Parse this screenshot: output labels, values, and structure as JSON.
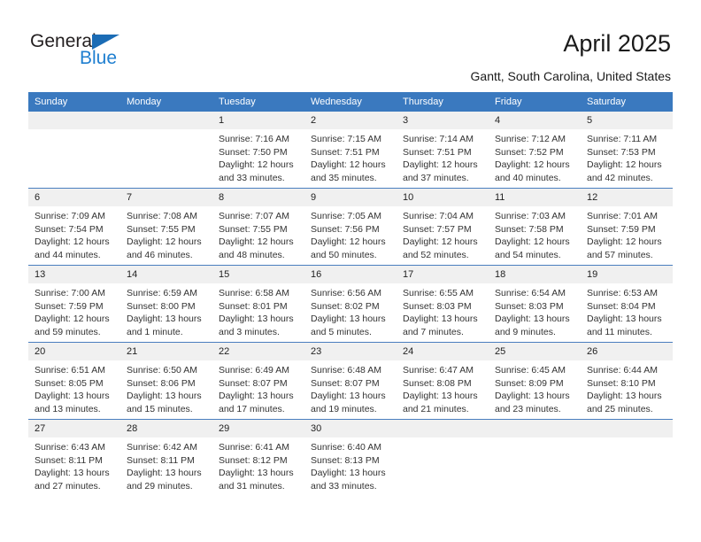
{
  "brand": {
    "name_part1": "General",
    "name_part2": "Blue",
    "triangle_icon": "triangle-icon",
    "accent_color": "#1f7fd0"
  },
  "header": {
    "title": "April 2025",
    "location": "Gantt, South Carolina, United States"
  },
  "calendar": {
    "header_bg": "#3a79bf",
    "daynum_bg": "#f0f0f0",
    "separator_color": "#4a7ebf",
    "weekdays": [
      "Sunday",
      "Monday",
      "Tuesday",
      "Wednesday",
      "Thursday",
      "Friday",
      "Saturday"
    ],
    "weeks": [
      [
        {
          "day": "",
          "sunrise": "",
          "sunset": "",
          "daylight_line1": "",
          "daylight_line2": ""
        },
        {
          "day": "",
          "sunrise": "",
          "sunset": "",
          "daylight_line1": "",
          "daylight_line2": ""
        },
        {
          "day": "1",
          "sunrise": "Sunrise: 7:16 AM",
          "sunset": "Sunset: 7:50 PM",
          "daylight_line1": "Daylight: 12 hours",
          "daylight_line2": "and 33 minutes."
        },
        {
          "day": "2",
          "sunrise": "Sunrise: 7:15 AM",
          "sunset": "Sunset: 7:51 PM",
          "daylight_line1": "Daylight: 12 hours",
          "daylight_line2": "and 35 minutes."
        },
        {
          "day": "3",
          "sunrise": "Sunrise: 7:14 AM",
          "sunset": "Sunset: 7:51 PM",
          "daylight_line1": "Daylight: 12 hours",
          "daylight_line2": "and 37 minutes."
        },
        {
          "day": "4",
          "sunrise": "Sunrise: 7:12 AM",
          "sunset": "Sunset: 7:52 PM",
          "daylight_line1": "Daylight: 12 hours",
          "daylight_line2": "and 40 minutes."
        },
        {
          "day": "5",
          "sunrise": "Sunrise: 7:11 AM",
          "sunset": "Sunset: 7:53 PM",
          "daylight_line1": "Daylight: 12 hours",
          "daylight_line2": "and 42 minutes."
        }
      ],
      [
        {
          "day": "6",
          "sunrise": "Sunrise: 7:09 AM",
          "sunset": "Sunset: 7:54 PM",
          "daylight_line1": "Daylight: 12 hours",
          "daylight_line2": "and 44 minutes."
        },
        {
          "day": "7",
          "sunrise": "Sunrise: 7:08 AM",
          "sunset": "Sunset: 7:55 PM",
          "daylight_line1": "Daylight: 12 hours",
          "daylight_line2": "and 46 minutes."
        },
        {
          "day": "8",
          "sunrise": "Sunrise: 7:07 AM",
          "sunset": "Sunset: 7:55 PM",
          "daylight_line1": "Daylight: 12 hours",
          "daylight_line2": "and 48 minutes."
        },
        {
          "day": "9",
          "sunrise": "Sunrise: 7:05 AM",
          "sunset": "Sunset: 7:56 PM",
          "daylight_line1": "Daylight: 12 hours",
          "daylight_line2": "and 50 minutes."
        },
        {
          "day": "10",
          "sunrise": "Sunrise: 7:04 AM",
          "sunset": "Sunset: 7:57 PM",
          "daylight_line1": "Daylight: 12 hours",
          "daylight_line2": "and 52 minutes."
        },
        {
          "day": "11",
          "sunrise": "Sunrise: 7:03 AM",
          "sunset": "Sunset: 7:58 PM",
          "daylight_line1": "Daylight: 12 hours",
          "daylight_line2": "and 54 minutes."
        },
        {
          "day": "12",
          "sunrise": "Sunrise: 7:01 AM",
          "sunset": "Sunset: 7:59 PM",
          "daylight_line1": "Daylight: 12 hours",
          "daylight_line2": "and 57 minutes."
        }
      ],
      [
        {
          "day": "13",
          "sunrise": "Sunrise: 7:00 AM",
          "sunset": "Sunset: 7:59 PM",
          "daylight_line1": "Daylight: 12 hours",
          "daylight_line2": "and 59 minutes."
        },
        {
          "day": "14",
          "sunrise": "Sunrise: 6:59 AM",
          "sunset": "Sunset: 8:00 PM",
          "daylight_line1": "Daylight: 13 hours",
          "daylight_line2": "and 1 minute."
        },
        {
          "day": "15",
          "sunrise": "Sunrise: 6:58 AM",
          "sunset": "Sunset: 8:01 PM",
          "daylight_line1": "Daylight: 13 hours",
          "daylight_line2": "and 3 minutes."
        },
        {
          "day": "16",
          "sunrise": "Sunrise: 6:56 AM",
          "sunset": "Sunset: 8:02 PM",
          "daylight_line1": "Daylight: 13 hours",
          "daylight_line2": "and 5 minutes."
        },
        {
          "day": "17",
          "sunrise": "Sunrise: 6:55 AM",
          "sunset": "Sunset: 8:03 PM",
          "daylight_line1": "Daylight: 13 hours",
          "daylight_line2": "and 7 minutes."
        },
        {
          "day": "18",
          "sunrise": "Sunrise: 6:54 AM",
          "sunset": "Sunset: 8:03 PM",
          "daylight_line1": "Daylight: 13 hours",
          "daylight_line2": "and 9 minutes."
        },
        {
          "day": "19",
          "sunrise": "Sunrise: 6:53 AM",
          "sunset": "Sunset: 8:04 PM",
          "daylight_line1": "Daylight: 13 hours",
          "daylight_line2": "and 11 minutes."
        }
      ],
      [
        {
          "day": "20",
          "sunrise": "Sunrise: 6:51 AM",
          "sunset": "Sunset: 8:05 PM",
          "daylight_line1": "Daylight: 13 hours",
          "daylight_line2": "and 13 minutes."
        },
        {
          "day": "21",
          "sunrise": "Sunrise: 6:50 AM",
          "sunset": "Sunset: 8:06 PM",
          "daylight_line1": "Daylight: 13 hours",
          "daylight_line2": "and 15 minutes."
        },
        {
          "day": "22",
          "sunrise": "Sunrise: 6:49 AM",
          "sunset": "Sunset: 8:07 PM",
          "daylight_line1": "Daylight: 13 hours",
          "daylight_line2": "and 17 minutes."
        },
        {
          "day": "23",
          "sunrise": "Sunrise: 6:48 AM",
          "sunset": "Sunset: 8:07 PM",
          "daylight_line1": "Daylight: 13 hours",
          "daylight_line2": "and 19 minutes."
        },
        {
          "day": "24",
          "sunrise": "Sunrise: 6:47 AM",
          "sunset": "Sunset: 8:08 PM",
          "daylight_line1": "Daylight: 13 hours",
          "daylight_line2": "and 21 minutes."
        },
        {
          "day": "25",
          "sunrise": "Sunrise: 6:45 AM",
          "sunset": "Sunset: 8:09 PM",
          "daylight_line1": "Daylight: 13 hours",
          "daylight_line2": "and 23 minutes."
        },
        {
          "day": "26",
          "sunrise": "Sunrise: 6:44 AM",
          "sunset": "Sunset: 8:10 PM",
          "daylight_line1": "Daylight: 13 hours",
          "daylight_line2": "and 25 minutes."
        }
      ],
      [
        {
          "day": "27",
          "sunrise": "Sunrise: 6:43 AM",
          "sunset": "Sunset: 8:11 PM",
          "daylight_line1": "Daylight: 13 hours",
          "daylight_line2": "and 27 minutes."
        },
        {
          "day": "28",
          "sunrise": "Sunrise: 6:42 AM",
          "sunset": "Sunset: 8:11 PM",
          "daylight_line1": "Daylight: 13 hours",
          "daylight_line2": "and 29 minutes."
        },
        {
          "day": "29",
          "sunrise": "Sunrise: 6:41 AM",
          "sunset": "Sunset: 8:12 PM",
          "daylight_line1": "Daylight: 13 hours",
          "daylight_line2": "and 31 minutes."
        },
        {
          "day": "30",
          "sunrise": "Sunrise: 6:40 AM",
          "sunset": "Sunset: 8:13 PM",
          "daylight_line1": "Daylight: 13 hours",
          "daylight_line2": "and 33 minutes."
        },
        {
          "day": "",
          "sunrise": "",
          "sunset": "",
          "daylight_line1": "",
          "daylight_line2": ""
        },
        {
          "day": "",
          "sunrise": "",
          "sunset": "",
          "daylight_line1": "",
          "daylight_line2": ""
        },
        {
          "day": "",
          "sunrise": "",
          "sunset": "",
          "daylight_line1": "",
          "daylight_line2": ""
        }
      ]
    ]
  }
}
